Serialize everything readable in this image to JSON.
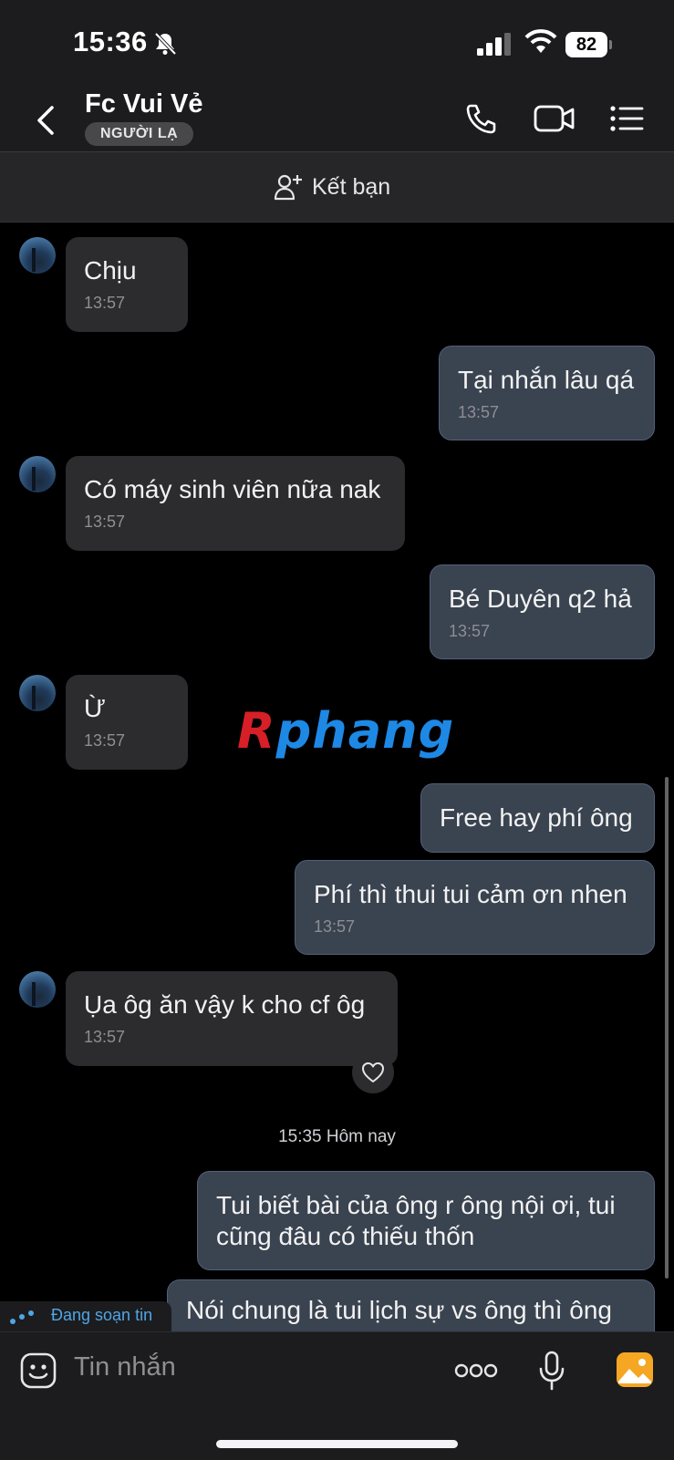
{
  "status_bar": {
    "time": "15:36",
    "battery": "82"
  },
  "header": {
    "name": "Fc Vui Vẻ",
    "badge": "NGƯỜI LẠ"
  },
  "add_friend": {
    "label": "Kết bạn"
  },
  "messages": [
    {
      "dir": "in",
      "text": "Chịu",
      "time": "13:57"
    },
    {
      "dir": "out",
      "text": "Tại nhắn lâu qá",
      "time": "13:57"
    },
    {
      "dir": "in",
      "text": "Có máy sinh viên nữa nak",
      "time": "13:57"
    },
    {
      "dir": "out",
      "text": "Bé Duyên q2 hả",
      "time": "13:57"
    },
    {
      "dir": "in",
      "text": "Ừ",
      "time": "13:57"
    },
    {
      "dir": "out",
      "text": "Free hay phí ông"
    },
    {
      "dir": "out",
      "text": "Phí thì thui tui cảm ơn nhen",
      "time": "13:57"
    },
    {
      "dir": "in",
      "text": "Ụa ôg ăn vậy k cho cf ôg",
      "time": "13:57"
    },
    {
      "dir": "out",
      "text_line1": "Tui biết bài của ông r ông nội ơi, tui",
      "text_line2": "cũng đâu có thiếu thốn"
    },
    {
      "dir": "out",
      "text": "Nói chung là tui lịch sự vs ông thì ông"
    }
  ],
  "day_separator": "15:35 Hôm nay",
  "watermark": {
    "part1": "R",
    "part2": "phang"
  },
  "typing_indicator": "Đang soạn tin",
  "composer": {
    "placeholder": "Tin nhắn"
  },
  "colors": {
    "incoming_bubble": "#2c2c2e",
    "outgoing_bubble": "#3a4350",
    "accent_blue": "#4fa6e6",
    "image_icon": "#f5a623"
  }
}
